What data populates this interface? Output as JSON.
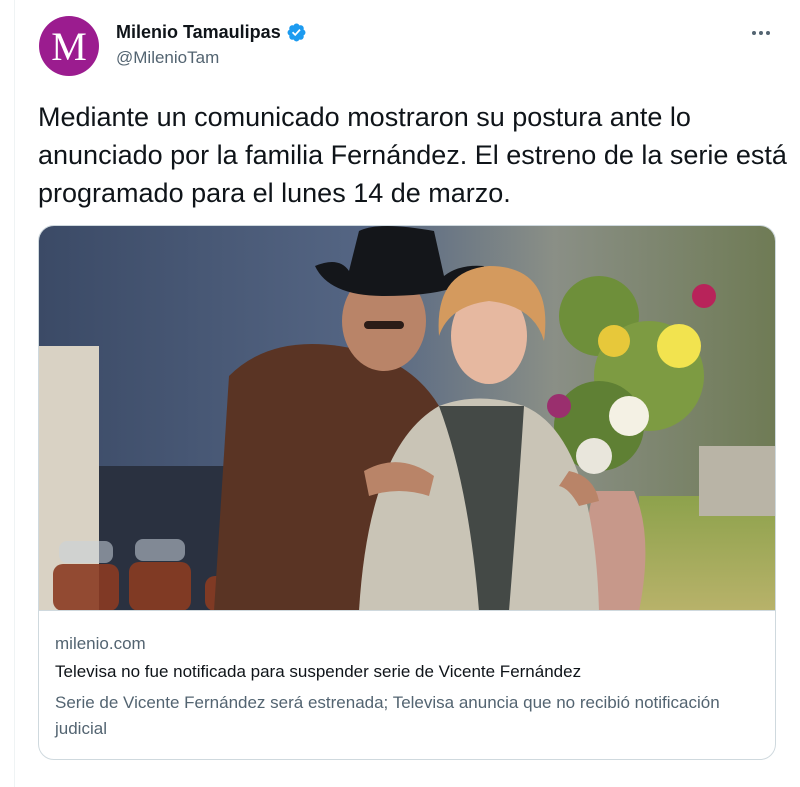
{
  "author": {
    "display_name": "Milenio Tamaulipas",
    "handle": "@MilenioTam",
    "avatar_letter": "M",
    "avatar_color": "#9b1c8f",
    "verified_color": "#1d9bf0"
  },
  "tweet": {
    "text": "Mediante un comunicado mostraron su postura ante lo anunciado por la familia Fernández. El estreno de la serie está programado para el lunes 14 de marzo."
  },
  "card": {
    "domain": "milenio.com",
    "title": "Televisa no fue notificada para suspender serie de Vicente Fernández",
    "description": "Serie de Vicente Fernández será estrenada; Televisa anuncia que no recibió notificación judicial"
  },
  "icons": {
    "more": "more-horizontal-icon",
    "verified": "verified-badge-icon"
  }
}
